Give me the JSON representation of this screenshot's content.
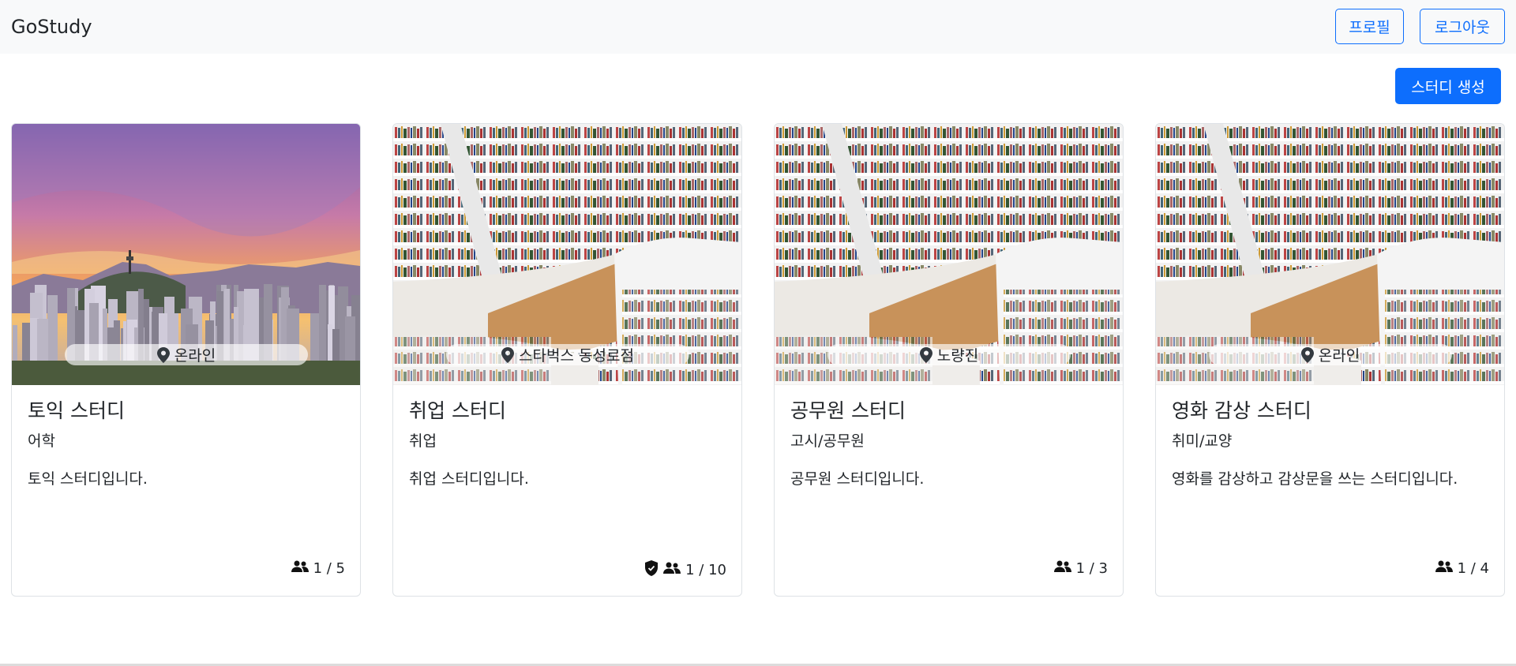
{
  "navbar": {
    "brand": "GoStudy",
    "profile_label": "프로필",
    "logout_label": "로그아웃"
  },
  "toolbar": {
    "create_label": "스터디 생성"
  },
  "colors": {
    "primary": "#0d6efd",
    "navbar_bg": "#f8f9fa"
  },
  "cards": [
    {
      "image": "seoul-skyline-sunset",
      "location": "온라인",
      "title": "토익 스터디",
      "category": "어학",
      "description": "토익 스터디입니다.",
      "members": "1 / 5",
      "verified": false
    },
    {
      "image": "library-bookshelves",
      "location": "스타벅스 동성로점",
      "title": "취업 스터디",
      "category": "취업",
      "description": "취업 스터디입니다.",
      "members": "1 / 10",
      "verified": true
    },
    {
      "image": "library-bookshelves",
      "location": "노량진",
      "title": "공무원 스터디",
      "category": "고시/공무원",
      "description": "공무원 스터디입니다.",
      "members": "1 / 3",
      "verified": false
    },
    {
      "image": "library-bookshelves",
      "location": "온라인",
      "title": "영화 감상 스터디",
      "category": "취미/교양",
      "description": "영화를 감상하고 감상문을 쓰는 스터디입니다.",
      "members": "1 / 4",
      "verified": false
    }
  ]
}
